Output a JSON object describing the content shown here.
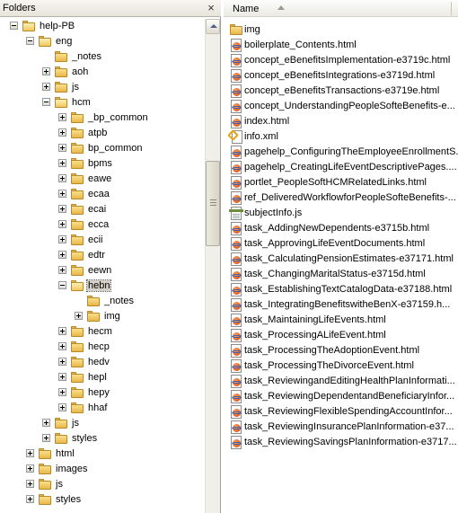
{
  "folders_pane": {
    "title": "Folders",
    "close_glyph": "×",
    "tree": [
      {
        "label": "help-PB",
        "depth": 0,
        "state": "expanded"
      },
      {
        "label": "eng",
        "depth": 1,
        "state": "expanded"
      },
      {
        "label": "_notes",
        "depth": 2,
        "state": "none"
      },
      {
        "label": "aoh",
        "depth": 2,
        "state": "collapsed"
      },
      {
        "label": "js",
        "depth": 2,
        "state": "collapsed"
      },
      {
        "label": "hcm",
        "depth": 2,
        "state": "expanded"
      },
      {
        "label": "_bp_common",
        "depth": 3,
        "state": "collapsed"
      },
      {
        "label": "atpb",
        "depth": 3,
        "state": "collapsed"
      },
      {
        "label": "bp_common",
        "depth": 3,
        "state": "collapsed"
      },
      {
        "label": "bpms",
        "depth": 3,
        "state": "collapsed"
      },
      {
        "label": "eawe",
        "depth": 3,
        "state": "collapsed"
      },
      {
        "label": "ecaa",
        "depth": 3,
        "state": "collapsed"
      },
      {
        "label": "ecai",
        "depth": 3,
        "state": "collapsed"
      },
      {
        "label": "ecca",
        "depth": 3,
        "state": "collapsed"
      },
      {
        "label": "ecii",
        "depth": 3,
        "state": "collapsed"
      },
      {
        "label": "edtr",
        "depth": 3,
        "state": "collapsed"
      },
      {
        "label": "eewn",
        "depth": 3,
        "state": "collapsed"
      },
      {
        "label": "hebn",
        "depth": 3,
        "state": "expanded",
        "selected": true
      },
      {
        "label": "_notes",
        "depth": 4,
        "state": "none"
      },
      {
        "label": "img",
        "depth": 4,
        "state": "collapsed"
      },
      {
        "label": "hecm",
        "depth": 3,
        "state": "collapsed"
      },
      {
        "label": "hecp",
        "depth": 3,
        "state": "collapsed"
      },
      {
        "label": "hedv",
        "depth": 3,
        "state": "collapsed"
      },
      {
        "label": "hepl",
        "depth": 3,
        "state": "collapsed"
      },
      {
        "label": "hepy",
        "depth": 3,
        "state": "collapsed"
      },
      {
        "label": "hhaf",
        "depth": 3,
        "state": "collapsed"
      },
      {
        "label": "js",
        "depth": 2,
        "state": "collapsed"
      },
      {
        "label": "styles",
        "depth": 2,
        "state": "collapsed"
      },
      {
        "label": "html",
        "depth": 1,
        "state": "collapsed"
      },
      {
        "label": "images",
        "depth": 1,
        "state": "collapsed"
      },
      {
        "label": "js",
        "depth": 1,
        "state": "collapsed"
      },
      {
        "label": "styles",
        "depth": 1,
        "state": "collapsed"
      }
    ]
  },
  "file_pane": {
    "column_name": "Name",
    "files": [
      {
        "name": "img",
        "type": "folder"
      },
      {
        "name": "boilerplate_Contents.html",
        "type": "html"
      },
      {
        "name": "concept_eBenefitsImplementation-e3719c.html",
        "type": "html"
      },
      {
        "name": "concept_eBenefitsIntegrations-e3719d.html",
        "type": "html"
      },
      {
        "name": "concept_eBenefitsTransactions-e3719e.html",
        "type": "html"
      },
      {
        "name": "concept_UnderstandingPeopleSofteBenefits-e...",
        "type": "html"
      },
      {
        "name": "index.html",
        "type": "html"
      },
      {
        "name": "info.xml",
        "type": "xml"
      },
      {
        "name": "pagehelp_ConfiguringTheEmployeeEnrollmentS...",
        "type": "html"
      },
      {
        "name": "pagehelp_CreatingLifeEventDescriptivePages....",
        "type": "html"
      },
      {
        "name": "portlet_PeopleSoftHCMRelatedLinks.html",
        "type": "html"
      },
      {
        "name": "ref_DeliveredWorkflowforPeopleSofteBenefits-...",
        "type": "html"
      },
      {
        "name": "subjectInfo.js",
        "type": "js"
      },
      {
        "name": "task_AddingNewDependents-e3715b.html",
        "type": "html"
      },
      {
        "name": "task_ApprovingLifeEventDocuments.html",
        "type": "html"
      },
      {
        "name": "task_CalculatingPensionEstimates-e37171.html",
        "type": "html"
      },
      {
        "name": "task_ChangingMaritalStatus-e3715d.html",
        "type": "html"
      },
      {
        "name": "task_EstablishingTextCatalogData-e37188.html",
        "type": "html"
      },
      {
        "name": "task_IntegratingBenefitswitheBenX-e37159.h...",
        "type": "html"
      },
      {
        "name": "task_MaintainingLifeEvents.html",
        "type": "html"
      },
      {
        "name": "task_ProcessingALifeEvent.html",
        "type": "html"
      },
      {
        "name": "task_ProcessingTheAdoptionEvent.html",
        "type": "html"
      },
      {
        "name": "task_ProcessingTheDivorceEvent.html",
        "type": "html"
      },
      {
        "name": "task_ReviewingandEditingHealthPlanInformati...",
        "type": "html"
      },
      {
        "name": "task_ReviewingDependentandBeneficiaryInfor...",
        "type": "html"
      },
      {
        "name": "task_ReviewingFlexibleSpendingAccountInfor...",
        "type": "html"
      },
      {
        "name": "task_ReviewingInsurancePlanInformation-e37...",
        "type": "html"
      },
      {
        "name": "task_ReviewingSavingsPlanInformation-e3717...",
        "type": "html"
      }
    ]
  },
  "colors": {
    "folder": "#f1c85e",
    "folder_border": "#b8892a",
    "selection": "#d4d0c8",
    "header": "#ebeae3"
  }
}
